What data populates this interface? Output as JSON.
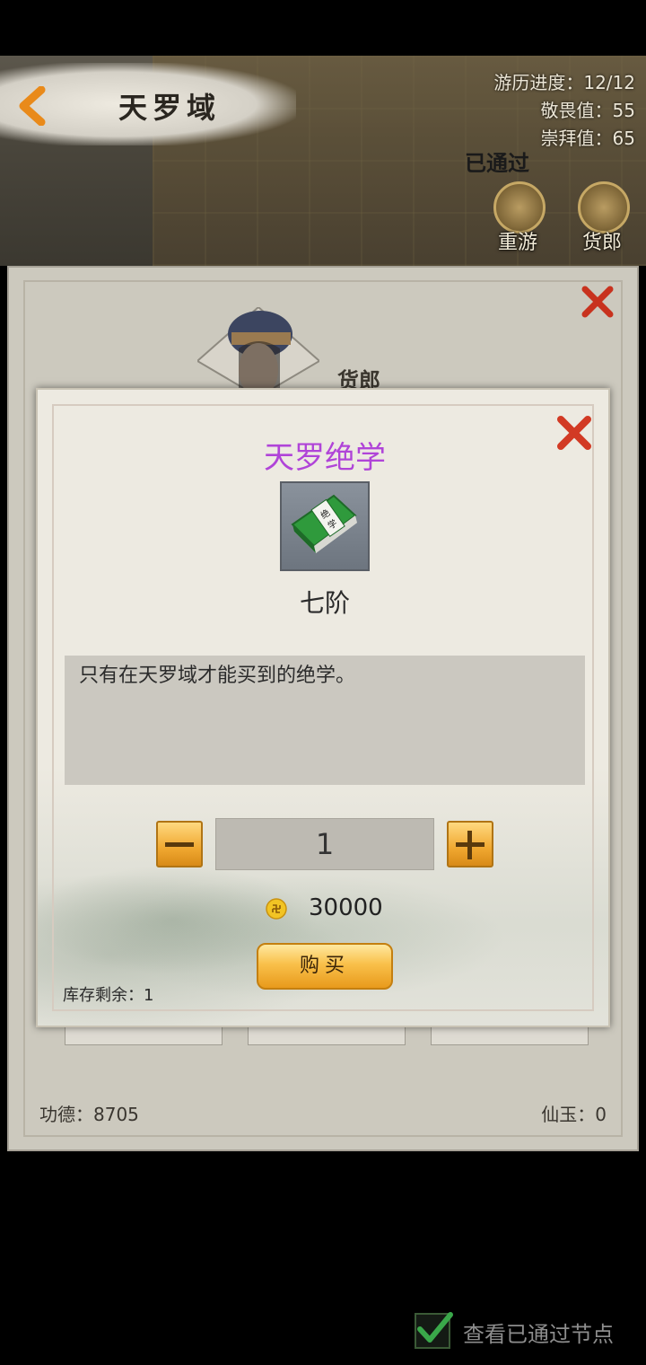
{
  "scene": {
    "title": "天罗域",
    "stats": {
      "travel_progress": "游历进度：12/12",
      "awe_value": "敬畏值：55",
      "worship_value": "崇拜值：65"
    },
    "passed_stamp": "已通过",
    "buttons": {
      "replay": "重游",
      "merchant": "货郎"
    }
  },
  "shop": {
    "npc_name": "货郎",
    "merit": "功德：8705",
    "jade": "仙玉：0"
  },
  "item_dialog": {
    "title": "天罗绝学",
    "icon_label": "绝学",
    "grade": "七阶",
    "description": "只有在天罗域才能买到的绝学。",
    "quantity": "1",
    "price": "30000",
    "buy_label": "购买",
    "stock": "库存剩余：1",
    "title_color": "#b044d8"
  },
  "footer": {
    "show_passed_nodes": "查看已通过节点",
    "checked": true
  }
}
